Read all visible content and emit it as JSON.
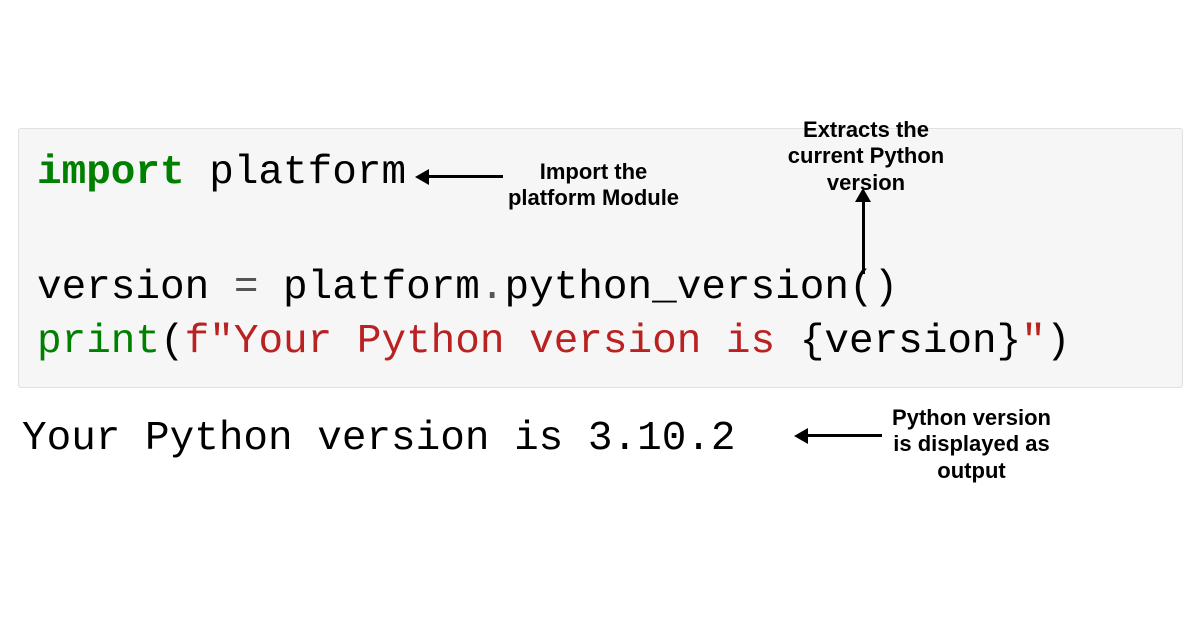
{
  "code": {
    "line1": {
      "import_kw": "import",
      "module": " platform"
    },
    "line2": {
      "varname": "version ",
      "eq": "=",
      "rhs1": " platform",
      "dot": ".",
      "func": "python_version",
      "parens": "()"
    },
    "line3": {
      "print_kw": "print",
      "open": "(",
      "fpre": "f\"Your Python version is ",
      "open_brace": "{",
      "interp": "version",
      "close_brace": "}",
      "fend": "\"",
      "close": ")"
    }
  },
  "output": "Your Python version is 3.10.2",
  "annotations": {
    "a1": "Import the platform Module",
    "a2": "Extracts the current Python version",
    "a3": "Python version is displayed as output"
  }
}
